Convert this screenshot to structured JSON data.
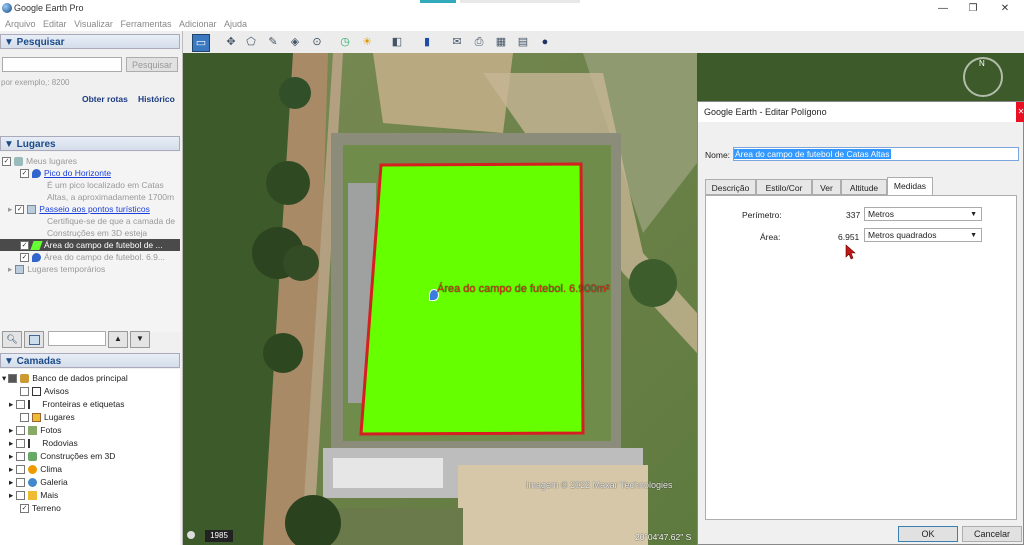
{
  "window": {
    "title": "Google Earth Pro",
    "minimize": "—",
    "maximize": "❐",
    "close": "✕"
  },
  "menu": [
    "Arquivo",
    "Editar",
    "Visualizar",
    "Ferramentas",
    "Adicionar",
    "Ajuda"
  ],
  "search": {
    "header": "▼ Pesquisar",
    "placeholder": "",
    "button": "Pesquisar",
    "hint": "por exemplo,: 8200",
    "routes": "Obter rotas",
    "history": "Histórico"
  },
  "places": {
    "header": "▼ Lugares",
    "items": [
      {
        "label": "Meus lugares"
      },
      {
        "label": "Pico do Horizonte"
      },
      {
        "label": "É um pico localizado em Catas"
      },
      {
        "label": "Altas, a aproximadamente 1700m"
      },
      {
        "label": "Passeio aos pontos turísticos"
      },
      {
        "label": "Certifique-se de que a camada de"
      },
      {
        "label": "Construções em 3D esteja"
      },
      {
        "label": "Área do campo de futebol de ..."
      },
      {
        "label": "Área do campo de futebol. 6.9..."
      },
      {
        "label": "Lugares temporários"
      }
    ]
  },
  "layers": {
    "header": "▼ Camadas",
    "items": [
      {
        "label": "Banco de dados principal"
      },
      {
        "label": "Avisos"
      },
      {
        "label": "Fronteiras e etiquetas"
      },
      {
        "label": "Lugares"
      },
      {
        "label": "Fotos"
      },
      {
        "label": "Rodovias"
      },
      {
        "label": "Construções em 3D"
      },
      {
        "label": "Clima"
      },
      {
        "label": "Galeria"
      },
      {
        "label": "Mais"
      },
      {
        "label": "Terreno"
      }
    ]
  },
  "map": {
    "label": "Área do campo de futebol. 6.900m²",
    "imagery": "Imagem © 2022 Maxar Technologies",
    "year": "1985",
    "coords": "20°04'47.62\" S",
    "compass": "N"
  },
  "dialog": {
    "title": "Google Earth - Editar Polígono",
    "close": "✕",
    "name_label": "Nome:",
    "name_value": "Área do campo de futebol de Catas Altas",
    "tabs": [
      "Descrição",
      "Estilo/Cor",
      "Ver",
      "Altitude",
      "Medidas"
    ],
    "perimeter_label": "Perímetro:",
    "perimeter_value": "337",
    "perimeter_unit": "Metros",
    "area_label": "Área:",
    "area_value": "6.951",
    "area_unit": "Metros quadrados",
    "ok": "OK",
    "cancel": "Cancelar"
  },
  "colors": {
    "polygon_fill": "#66ff00",
    "polygon_outline": "#d42020",
    "label": "#d43a1a"
  }
}
